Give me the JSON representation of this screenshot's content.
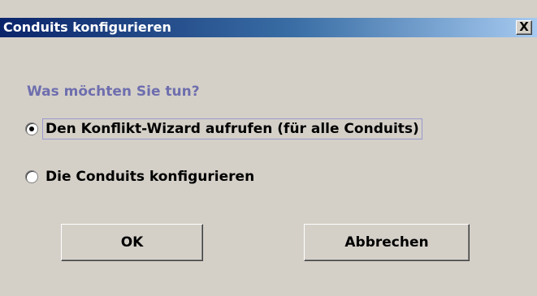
{
  "window": {
    "title": "Conduits konfigurieren",
    "close_label": "X"
  },
  "dialog": {
    "question": "Was möchten Sie tun?",
    "options": [
      {
        "label": "Den Konflikt-Wizard aufrufen (für alle Conduits)",
        "selected": true
      },
      {
        "label": "Die Conduits konfigurieren",
        "selected": false
      }
    ],
    "buttons": {
      "ok_label": "OK",
      "cancel_label": "Abbrechen"
    }
  },
  "colors": {
    "titlebar_start": "#0a246a",
    "titlebar_end": "#a6caf0",
    "background": "#d4d0c8",
    "question_text": "#6e6eae"
  }
}
